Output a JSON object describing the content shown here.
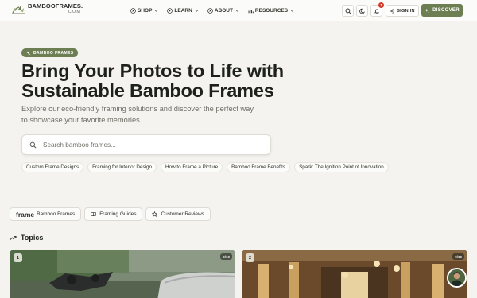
{
  "brand": {
    "name": "BAMBOOFRAMES.",
    "tld": "COM",
    "accent": "#6c7e52"
  },
  "nav": [
    {
      "label": "SHOP",
      "icon": "compass-icon"
    },
    {
      "label": "LEARN",
      "icon": "compass-icon"
    },
    {
      "label": "ABOUT",
      "icon": "compass-icon"
    },
    {
      "label": "RESOURCES",
      "icon": "chart-icon"
    }
  ],
  "header": {
    "notification_count": "1",
    "signin_label": "SIGN IN",
    "discover_label": "DISCOVER"
  },
  "hero": {
    "badge": "BAMBOO FRAMES",
    "title": "Bring Your Photos to Life with Sustainable Bamboo Frames",
    "subtitle": "Explore our eco-friendly framing solutions and discover the perfect way to showcase your favorite memories",
    "search_placeholder": "Search bamboo frames..."
  },
  "chips": [
    "Custom Frame Designs",
    "Framing for Interior Design",
    "How to Frame a Picture",
    "Bamboo Frame Benefits",
    "Spark: The Ignition Point of Innovation"
  ],
  "tabs": {
    "tab1_word": "frame",
    "tab1_label": "Bamboo Frames",
    "tab2_label": "Framing Guides",
    "tab3_label": "Customer Reviews"
  },
  "topics": {
    "heading": "Topics",
    "cards": [
      {
        "number": "1",
        "score": "9/10"
      },
      {
        "number": "2",
        "score": "9/10"
      }
    ]
  }
}
